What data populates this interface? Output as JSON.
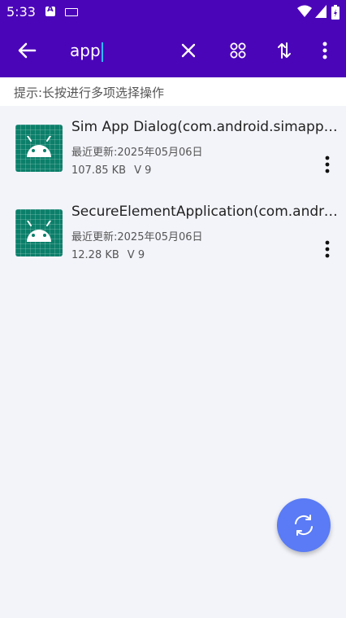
{
  "status_bar": {
    "time": "5:33"
  },
  "toolbar": {
    "search_value": "app"
  },
  "hint": {
    "text": "提示:长按进行多项选择操作"
  },
  "apps": [
    {
      "title": "Sim App Dialog(com.android.simappdialog)",
      "updated": "最近更新:2025年05月06日",
      "size": "107.85 KB",
      "version": "V 9"
    },
    {
      "title": "SecureElementApplication(com.android.se)",
      "updated": "最近更新:2025年05月06日",
      "size": "12.28 KB",
      "version": "V 9"
    }
  ],
  "colors": {
    "header": "#4b05b9",
    "background": "#f3f4fa",
    "fab": "#5a7bf5",
    "app_icon": "#0b7f6a"
  }
}
